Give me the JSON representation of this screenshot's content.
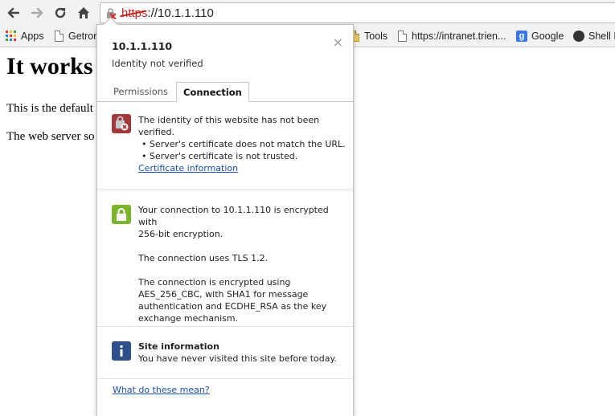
{
  "toolbar": {
    "url_scheme": "https",
    "url_rest": "://10.1.1.110"
  },
  "bookmarks": [
    {
      "label": "Apps"
    },
    {
      "label": "Getron"
    },
    {
      "label": "Tools"
    },
    {
      "label": "https://intranet.trien..."
    },
    {
      "label": "Google"
    },
    {
      "label": "Shell I"
    }
  ],
  "page": {
    "heading": "It works",
    "para1": "This is the default w",
    "para2": "The web server so"
  },
  "popup": {
    "title": "10.1.1.110",
    "subtitle": "Identity not verified",
    "close": "×",
    "tabs": [
      {
        "label": "Permissions"
      },
      {
        "label": "Connection"
      }
    ],
    "identity": {
      "line1": "The identity of this website has not been",
      "line2": "verified.",
      "bullet1": "• Server's certificate does not match the URL.",
      "bullet2": "• Server's certificate is not trusted.",
      "link": "Certificate information"
    },
    "connection": {
      "line1": "Your connection to 10.1.1.110 is encrypted with",
      "line2": "256-bit encryption.",
      "tls": "The connection uses TLS 1.2.",
      "cipher1": "The connection is encrypted using",
      "cipher2": "AES_256_CBC, with SHA1 for message",
      "cipher3": "authentication and ECDHE_RSA as the key",
      "cipher4": "exchange mechanism."
    },
    "site": {
      "title": "Site information",
      "text": "You have never visited this site before today."
    },
    "help_link": "What do these mean?"
  },
  "colors": {
    "error": "#a33a3a",
    "secure": "#7ab52c",
    "info": "#2d4f8c",
    "link": "#1a4fb5"
  }
}
